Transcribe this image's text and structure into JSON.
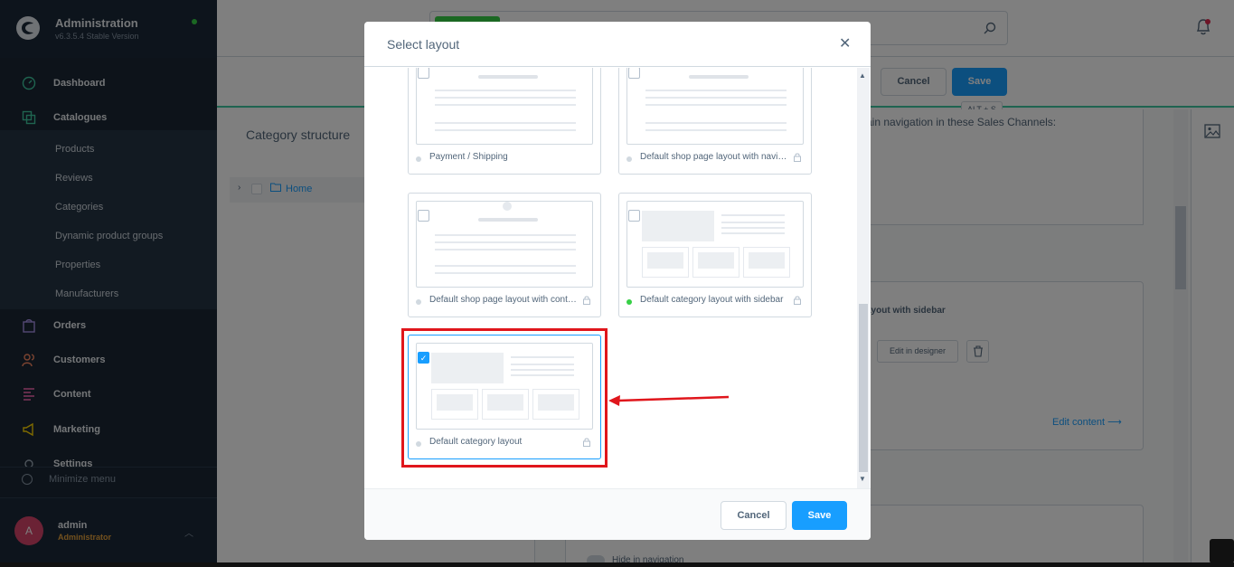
{
  "app": {
    "title": "Administration",
    "version": "v6.3.5.4 Stable Version"
  },
  "nav": {
    "items": [
      {
        "label": "Dashboard"
      },
      {
        "label": "Catalogues"
      },
      {
        "label": "Orders"
      },
      {
        "label": "Customers"
      },
      {
        "label": "Content"
      },
      {
        "label": "Marketing"
      },
      {
        "label": "Settings"
      }
    ],
    "catalogue_sub": [
      "Products",
      "Reviews",
      "Categories",
      "Dynamic product groups",
      "Properties",
      "Manufacturers"
    ],
    "minimize": "Minimize menu"
  },
  "user": {
    "initial": "A",
    "name": "admin",
    "role": "Administrator"
  },
  "toolbar": {
    "cancel": "Cancel",
    "save": "Save",
    "save_shortcut": "ALT + S"
  },
  "category": {
    "title": "Category structure",
    "tree_root": "Home"
  },
  "background": {
    "nav_text": "ain navigation in these Sales Channels:",
    "layout_name": "ayout with sidebar",
    "edit_designer": "Edit in designer",
    "edit_content": "Edit content",
    "hide_nav": "Hide in navigation"
  },
  "modal": {
    "title": "Select layout",
    "cancel": "Cancel",
    "save": "Save",
    "layouts": [
      {
        "label": "Payment / Shipping",
        "checked": false,
        "active": false,
        "locked": false
      },
      {
        "label": "Default shop page layout with navigation",
        "checked": false,
        "active": false,
        "locked": true
      },
      {
        "label": "Default shop page layout with contact form",
        "checked": false,
        "active": false,
        "locked": true
      },
      {
        "label": "Default category layout with sidebar",
        "checked": false,
        "active": true,
        "locked": true
      },
      {
        "label": "Default category layout",
        "checked": true,
        "active": false,
        "locked": true
      }
    ]
  },
  "colors": {
    "accent": "#189eff",
    "sidebar": "#1a2634",
    "annotation": "#e0161c",
    "active_dot": "#37d046"
  }
}
